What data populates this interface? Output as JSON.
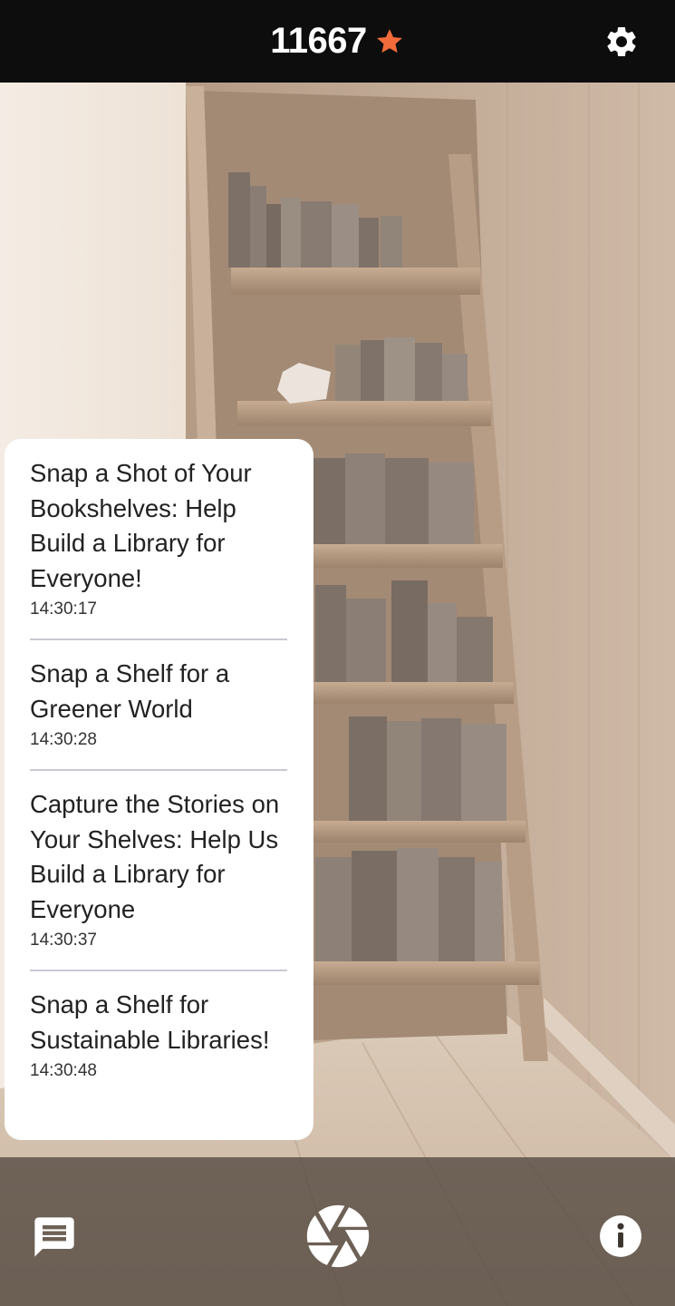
{
  "header": {
    "score": "11667",
    "star_icon": "star-icon",
    "star_color": "#f26b3a",
    "settings_icon": "gear-icon"
  },
  "notifications": [
    {
      "title": "Snap a Shot of Your Bookshelves: Help Build a Library for Everyone!",
      "time": "14:30:17"
    },
    {
      "title": "Snap a Shelf for a Greener World",
      "time": "14:30:28"
    },
    {
      "title": "Capture the Stories on Your Shelves: Help Us Build a Library for Everyone",
      "time": "14:30:37"
    },
    {
      "title": "Snap a Shelf for Sustainable Libraries!",
      "time": "14:30:48"
    }
  ],
  "footer": {
    "chat_icon": "chat-icon",
    "shutter_icon": "camera-shutter-icon",
    "info_icon": "info-icon"
  },
  "colors": {
    "topbar": "#0d0d0d",
    "panel": "#ffffff",
    "divider": "#c9c9d6"
  }
}
